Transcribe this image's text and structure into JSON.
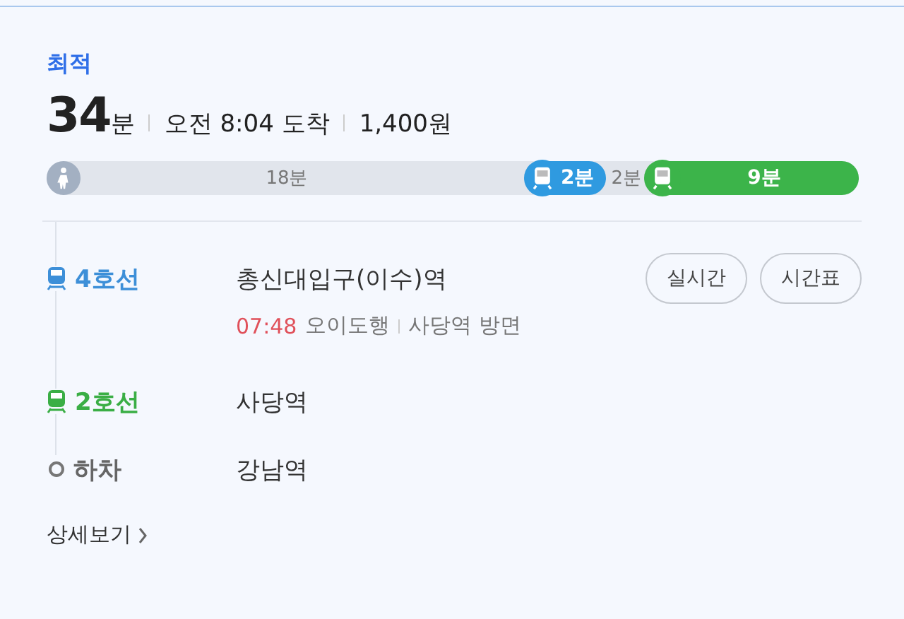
{
  "badge": "최적",
  "summary": {
    "duration": "34",
    "duration_unit": "분",
    "arrival": "오전 8:04 도착",
    "fare": "1,400원"
  },
  "timeline": [
    {
      "kind": "walk",
      "label": "18분",
      "icon": true
    },
    {
      "kind": "subway",
      "label": "2분",
      "color": "#2f9ae0"
    },
    {
      "kind": "walk",
      "label": "2분",
      "icon": false
    },
    {
      "kind": "subway",
      "label": "9분",
      "color": "#3cb44a"
    }
  ],
  "steps": [
    {
      "kind": "subway",
      "line": "4호선",
      "color": "#3d8fd8",
      "station": "총신대입구(이수)역",
      "detail": {
        "time": "07:48",
        "destination": "오이도행",
        "direction": "사당역 방면"
      },
      "buttons": [
        "실시간",
        "시간표"
      ]
    },
    {
      "kind": "subway",
      "line": "2호선",
      "color": "#3aae45",
      "station": "사당역"
    },
    {
      "kind": "alight",
      "line": "하차",
      "station": "강남역"
    }
  ],
  "more_link": "상세보기"
}
